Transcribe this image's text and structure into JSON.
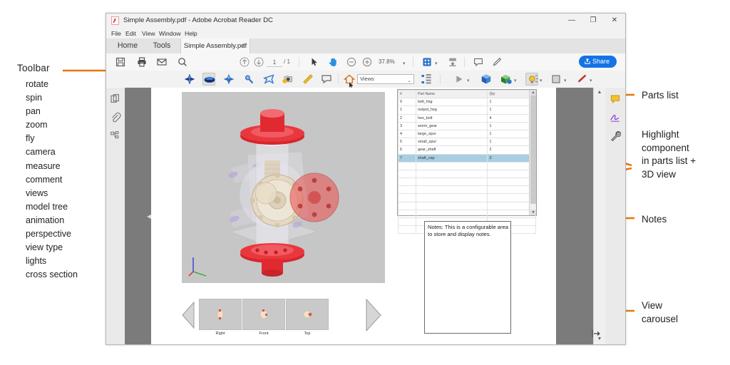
{
  "annotations": {
    "toolbar": {
      "heading": "Toolbar",
      "items": [
        "rotate",
        "spin",
        "pan",
        "zoom",
        "fly",
        "camera",
        "measure",
        "comment",
        "views",
        "model tree",
        "animation",
        "perspective",
        "view type",
        "lights",
        "cross section"
      ]
    },
    "right": {
      "parts_list": "Parts list",
      "highlight": "Highlight\ncomponent\nin parts list +\n3D view",
      "notes": "Notes",
      "view_carousel": "View\ncarousel"
    },
    "arrow_color": "#E8760B"
  },
  "window": {
    "title": "Simple Assembly.pdf - Adobe Acrobat Reader DC",
    "controls": {
      "minimize": "—",
      "maximize": "❐",
      "close": "✕"
    },
    "menu": [
      "File",
      "Edit",
      "View",
      "Window",
      "Help"
    ],
    "tabs": [
      {
        "label": "Home"
      },
      {
        "label": "Tools"
      },
      {
        "label": "Simple Assembly.pdf",
        "close": "×",
        "active": true
      }
    ]
  },
  "toolbar_main": {
    "icons": [
      "save-icon",
      "print-icon",
      "email-icon",
      "search-icon"
    ],
    "page_current": "1",
    "page_total": "/ 1",
    "nav": [
      "prev-page-icon",
      "next-page-icon"
    ],
    "tools": [
      "select-icon",
      "hand-icon",
      "zoom-out-icon",
      "zoom-in-icon"
    ],
    "zoom_level": "37.8%",
    "zoom_caret": "▾",
    "right_tools": [
      "fit-page-icon",
      "page-scroll-icon",
      "comment-icon",
      "highlight-icon"
    ],
    "share_label": "Share"
  },
  "toolbar_3d": {
    "tools": [
      {
        "name": "rotate-icon"
      },
      {
        "name": "spin-icon",
        "selected": true
      },
      {
        "name": "pan-icon"
      },
      {
        "name": "zoom-icon"
      },
      {
        "name": "fly-icon"
      },
      {
        "name": "camera-icon"
      },
      {
        "name": "measure-icon"
      },
      {
        "name": "comment-icon"
      },
      {
        "name": "home-view-icon"
      }
    ],
    "views_select": {
      "value": "Views",
      "caret": "⌄"
    },
    "right_tools": [
      "model-tree-icon",
      "animation-icon",
      "perspective-icon",
      "view-type-icon",
      "lights-icon",
      "cross-section-icon"
    ]
  },
  "left_rail": {
    "icons": [
      "page-thumbnails-icon",
      "attachments-icon",
      "model-tree-icon"
    ]
  },
  "right_rail": {
    "icons": [
      "comment-icon",
      "fill-and-sign-icon",
      "tools-icon"
    ]
  },
  "parts_list": {
    "columns": [
      "#",
      "Part Name",
      "Qty"
    ],
    "rows": [
      {
        "id": "0",
        "name": "belt_hsg",
        "qty": "1"
      },
      {
        "id": "1",
        "name": "output_hsg",
        "qty": "1"
      },
      {
        "id": "2",
        "name": "hex_bolt",
        "qty": "4"
      },
      {
        "id": "3",
        "name": "worm_gear",
        "qty": "1"
      },
      {
        "id": "4",
        "name": "large_spur",
        "qty": "1"
      },
      {
        "id": "5",
        "name": "small_spur",
        "qty": "1"
      },
      {
        "id": "6",
        "name": "gear_shaft",
        "qty": "2"
      },
      {
        "id": "7",
        "name": "shaft_cap",
        "qty": "3",
        "selected": true
      }
    ],
    "highlight_color": "#A8CEE2",
    "empty_rows": 9
  },
  "notes": {
    "text": "Notes: This is a configurable area to store and display notes."
  },
  "carousel": {
    "prev": "prev-view-icon",
    "next": "next-view-icon",
    "items": [
      {
        "label": "Right"
      },
      {
        "label": "Front"
      },
      {
        "label": "Top"
      }
    ]
  },
  "model": {
    "name": "gearbox-assembly-3d-view",
    "axis_labels": [
      "x",
      "y",
      "z"
    ]
  }
}
